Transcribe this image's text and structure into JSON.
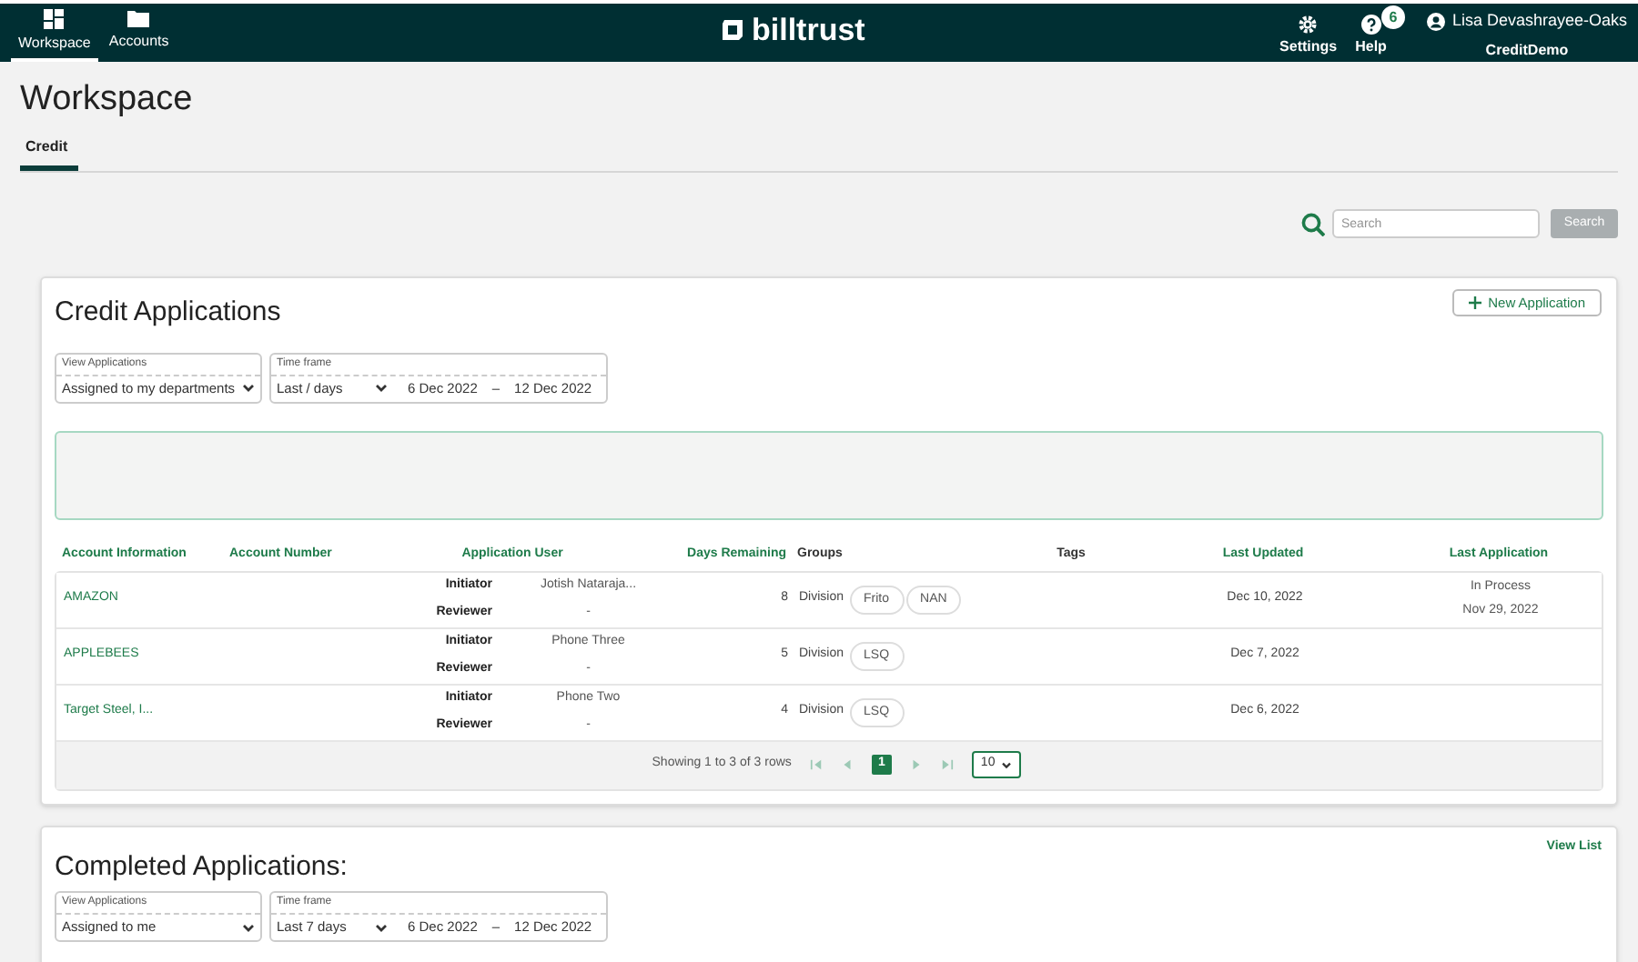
{
  "nav": [
    {
      "label": "Workspace",
      "kind": "grid",
      "selected": true
    },
    {
      "label": "Accounts",
      "kind": "folder",
      "selected": false
    }
  ],
  "logo": "billtrust",
  "header_actions": [
    {
      "label": "Settings",
      "kind": "gear"
    },
    {
      "label": "Help",
      "kind": "help"
    }
  ],
  "notification_badge": "6",
  "user": {
    "name": "Lisa Devashrayee-Oaks",
    "company": "CreditDemo"
  },
  "page_title": "Workspace",
  "tabs": [
    {
      "label": "Credit",
      "selected": true
    }
  ],
  "search": {
    "placeholder": "Search",
    "button": "Search",
    "disabled": true
  },
  "credit_applications": {
    "title": "Credit Applications",
    "new_button": "New Application",
    "filters": {
      "view_label": "View Applications",
      "view_value": "Assigned to my departments",
      "time_label": "Time frame",
      "time_value": "Last / days",
      "from": "6 Dec 2022",
      "separator": "–",
      "to": "12 Dec 2022"
    },
    "table": {
      "columns": [
        "Account Information",
        "Account Number",
        "Application User",
        "Days Remaining",
        "Groups",
        "Tags",
        "Last Updated",
        "Last Application"
      ],
      "rows": [
        {
          "account": "AMAZON",
          "roles": [
            {
              "role": "Initiator",
              "user": "Jotish Nataraja..."
            },
            {
              "role": "Reviewer",
              "user": "-"
            }
          ],
          "days_remaining": "8",
          "group_type": "Division",
          "groups": [
            "Frito",
            "NAN"
          ],
          "last_updated": "Dec 10, 2022",
          "last_application": [
            "In Process",
            "Nov 29, 2022"
          ]
        },
        {
          "account": "APPLEBEES",
          "roles": [
            {
              "role": "Initiator",
              "user": "Phone Three"
            },
            {
              "role": "Reviewer",
              "user": "-"
            }
          ],
          "days_remaining": "5",
          "group_type": "Division",
          "groups": [
            "LSQ"
          ],
          "last_updated": "Dec 7, 2022",
          "last_application": []
        },
        {
          "account": "Target Steel, I...",
          "roles": [
            {
              "role": "Initiator",
              "user": "Phone Two"
            },
            {
              "role": "Reviewer",
              "user": "-"
            }
          ],
          "days_remaining": "4",
          "group_type": "Division",
          "groups": [
            "LSQ"
          ],
          "last_updated": "Dec 6, 2022",
          "last_application": []
        }
      ]
    },
    "footer": {
      "summary": "Showing 1 to 3 of 3 rows",
      "pages": [
        {
          "label": "1",
          "selected": true
        }
      ],
      "page_size": "10"
    }
  },
  "completed_applications": {
    "title": "Completed Applications:",
    "view_list": "View List",
    "filters": {
      "view_label": "View Applications",
      "view_value": "Assigned to me",
      "time_label": "Time frame",
      "time_value": "Last 7 days",
      "from": "6 Dec 2022",
      "separator": "–",
      "to": "12 Dec 2022"
    }
  }
}
